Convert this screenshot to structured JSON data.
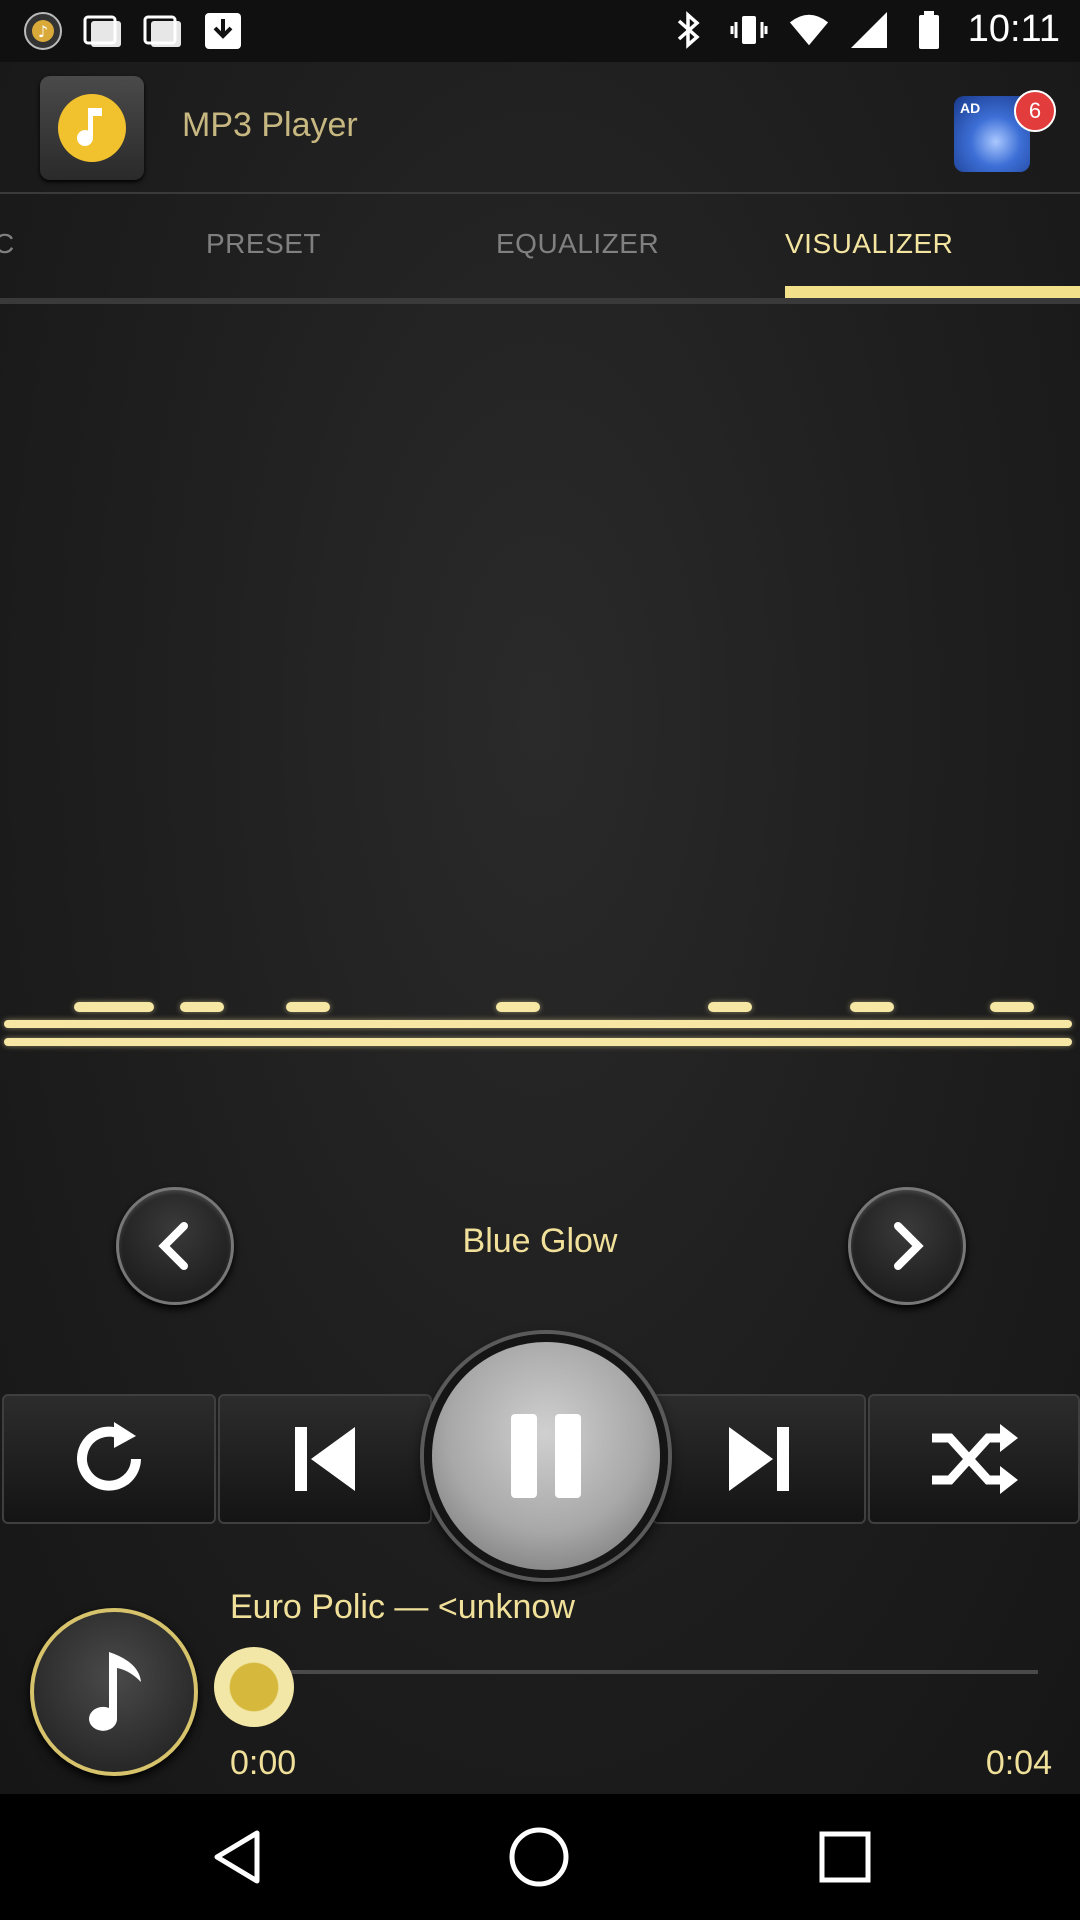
{
  "status_bar": {
    "time": "10:11",
    "icons": [
      "app-icon",
      "bluetooth-icon",
      "vibrate-icon",
      "wifi-icon",
      "cell-signal-icon",
      "battery-icon"
    ]
  },
  "header": {
    "title": "MP3 Player",
    "ad_label": "AD",
    "ad_count": "6"
  },
  "tabs": [
    {
      "label": "C",
      "active": false
    },
    {
      "label": "PRESET",
      "active": false
    },
    {
      "label": "EQUALIZER",
      "active": false
    },
    {
      "label": "VISUALIZER",
      "active": true
    }
  ],
  "visualizer": {
    "preset_name": "Blue Glow"
  },
  "controls": [
    "repeat-icon",
    "previous-icon",
    "pause-icon",
    "next-icon",
    "shuffle-icon"
  ],
  "now_playing": {
    "track": "Euro Polic — <unknow",
    "elapsed": "0:00",
    "duration": "0:04",
    "progress": 0.0
  },
  "colors": {
    "accent": "#f3e08a",
    "tab_inactive": "#808080",
    "background": "#1c1c1c"
  }
}
